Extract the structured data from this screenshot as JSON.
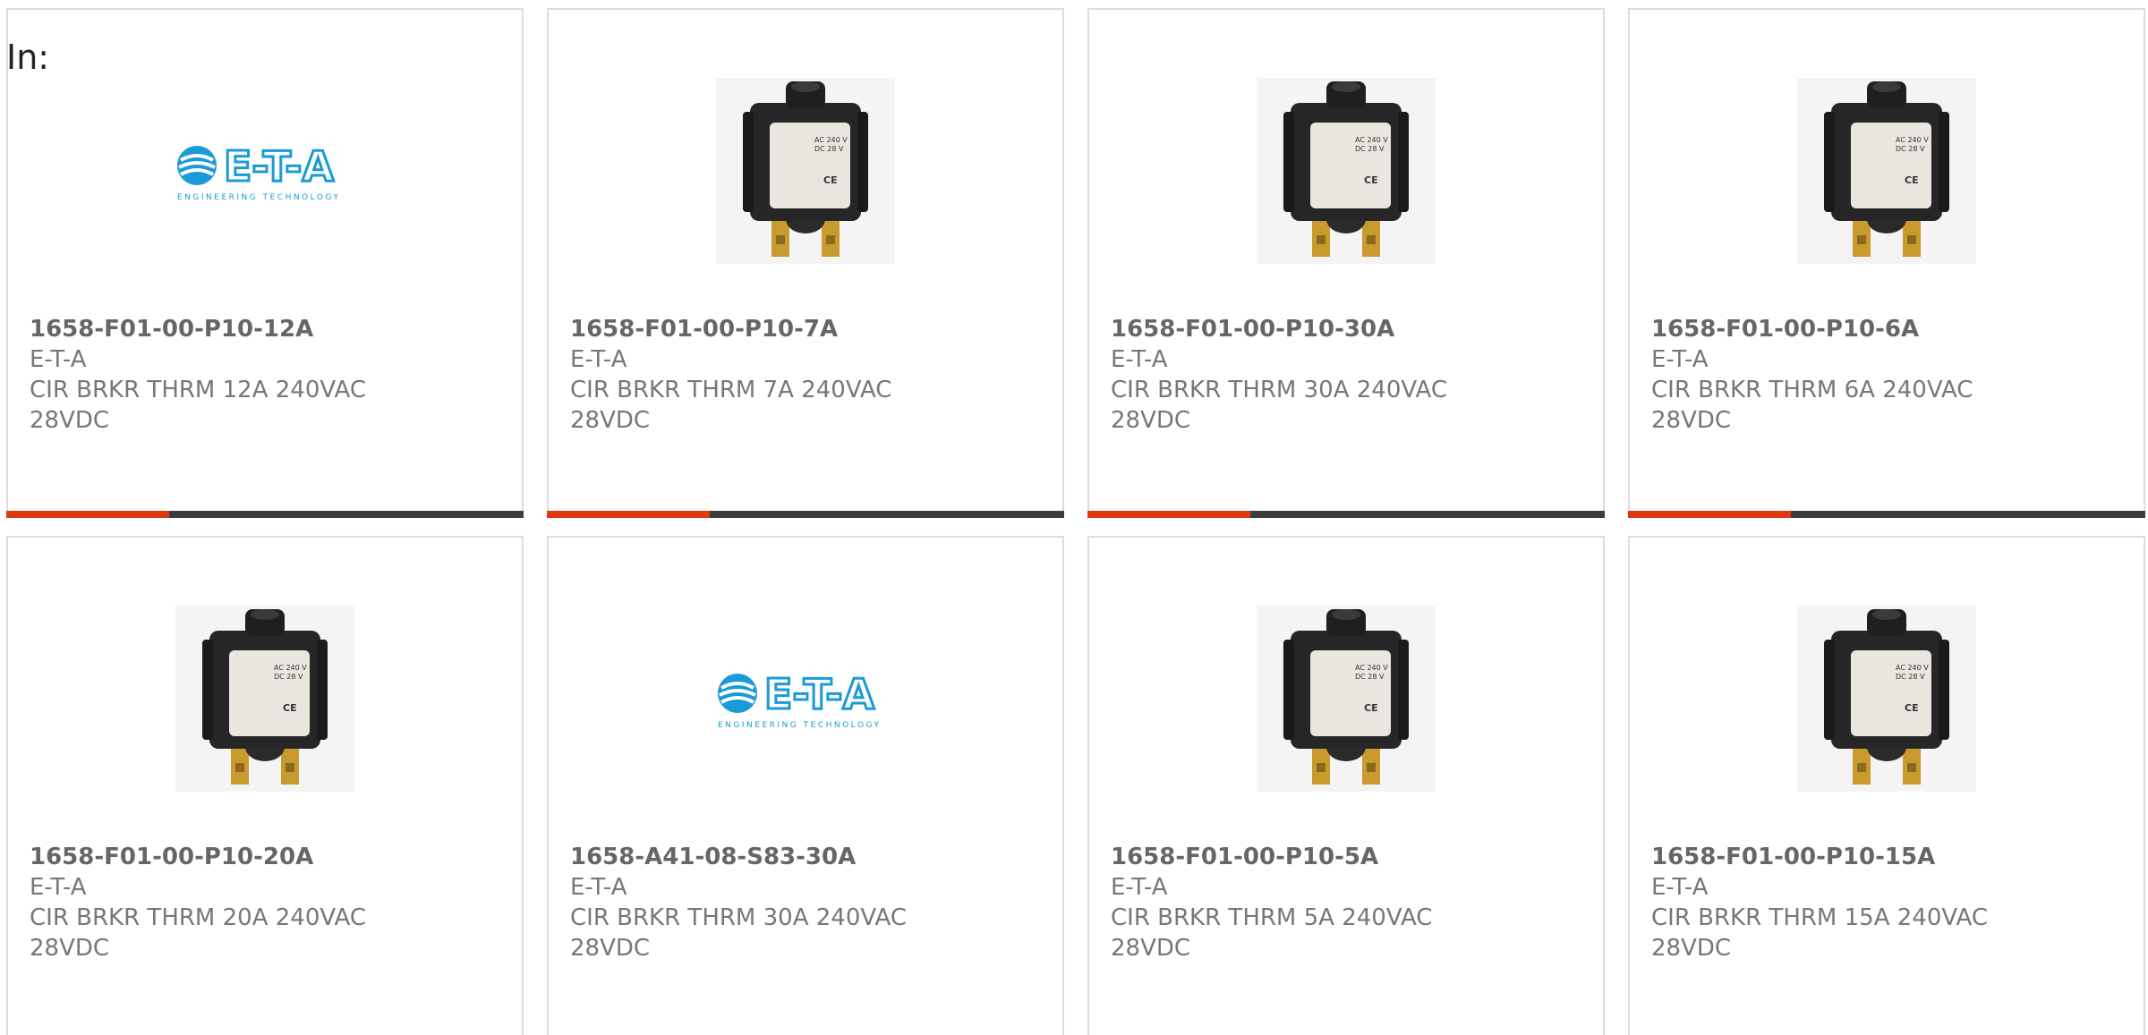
{
  "header": {
    "in_label": "In:"
  },
  "colors": {
    "accent": "#e0390f",
    "bar": "#3d3d3d",
    "border": "#dddddd",
    "logo_blue": "#1a9ad6"
  },
  "products": [
    {
      "part": "1658-F01-00-P10-12A",
      "brand": "E-T-A",
      "desc": "CIR BRKR THRM 12A 240VAC 28VDC",
      "image": "eta-logo"
    },
    {
      "part": "1658-F01-00-P10-7A",
      "brand": "E-T-A",
      "desc": "CIR BRKR THRM 7A 240VAC 28VDC",
      "image": "circuit-breaker"
    },
    {
      "part": "1658-F01-00-P10-30A",
      "brand": "E-T-A",
      "desc": "CIR BRKR THRM 30A 240VAC 28VDC",
      "image": "circuit-breaker"
    },
    {
      "part": "1658-F01-00-P10-6A",
      "brand": "E-T-A",
      "desc": "CIR BRKR THRM 6A 240VAC 28VDC",
      "image": "circuit-breaker"
    },
    {
      "part": "1658-F01-00-P10-20A",
      "brand": "E-T-A",
      "desc": "CIR BRKR THRM 20A 240VAC 28VDC",
      "image": "circuit-breaker"
    },
    {
      "part": "1658-A41-08-S83-30A",
      "brand": "E-T-A",
      "desc": "CIR BRKR THRM 30A 240VAC 28VDC",
      "image": "eta-logo"
    },
    {
      "part": "1658-F01-00-P10-5A",
      "brand": "E-T-A",
      "desc": "CIR BRKR THRM 5A 240VAC 28VDC",
      "image": "circuit-breaker"
    },
    {
      "part": "1658-F01-00-P10-15A",
      "brand": "E-T-A",
      "desc": "CIR BRKR THRM 15A 240VAC 28VDC",
      "image": "circuit-breaker"
    }
  ],
  "logo": {
    "text": "E-T-A",
    "tagline": "ENGINEERING TECHNOLOGY"
  },
  "breaker": {
    "label_line1": "AC 240 V",
    "label_line2": "DC 28 V",
    "mark": "CE"
  }
}
